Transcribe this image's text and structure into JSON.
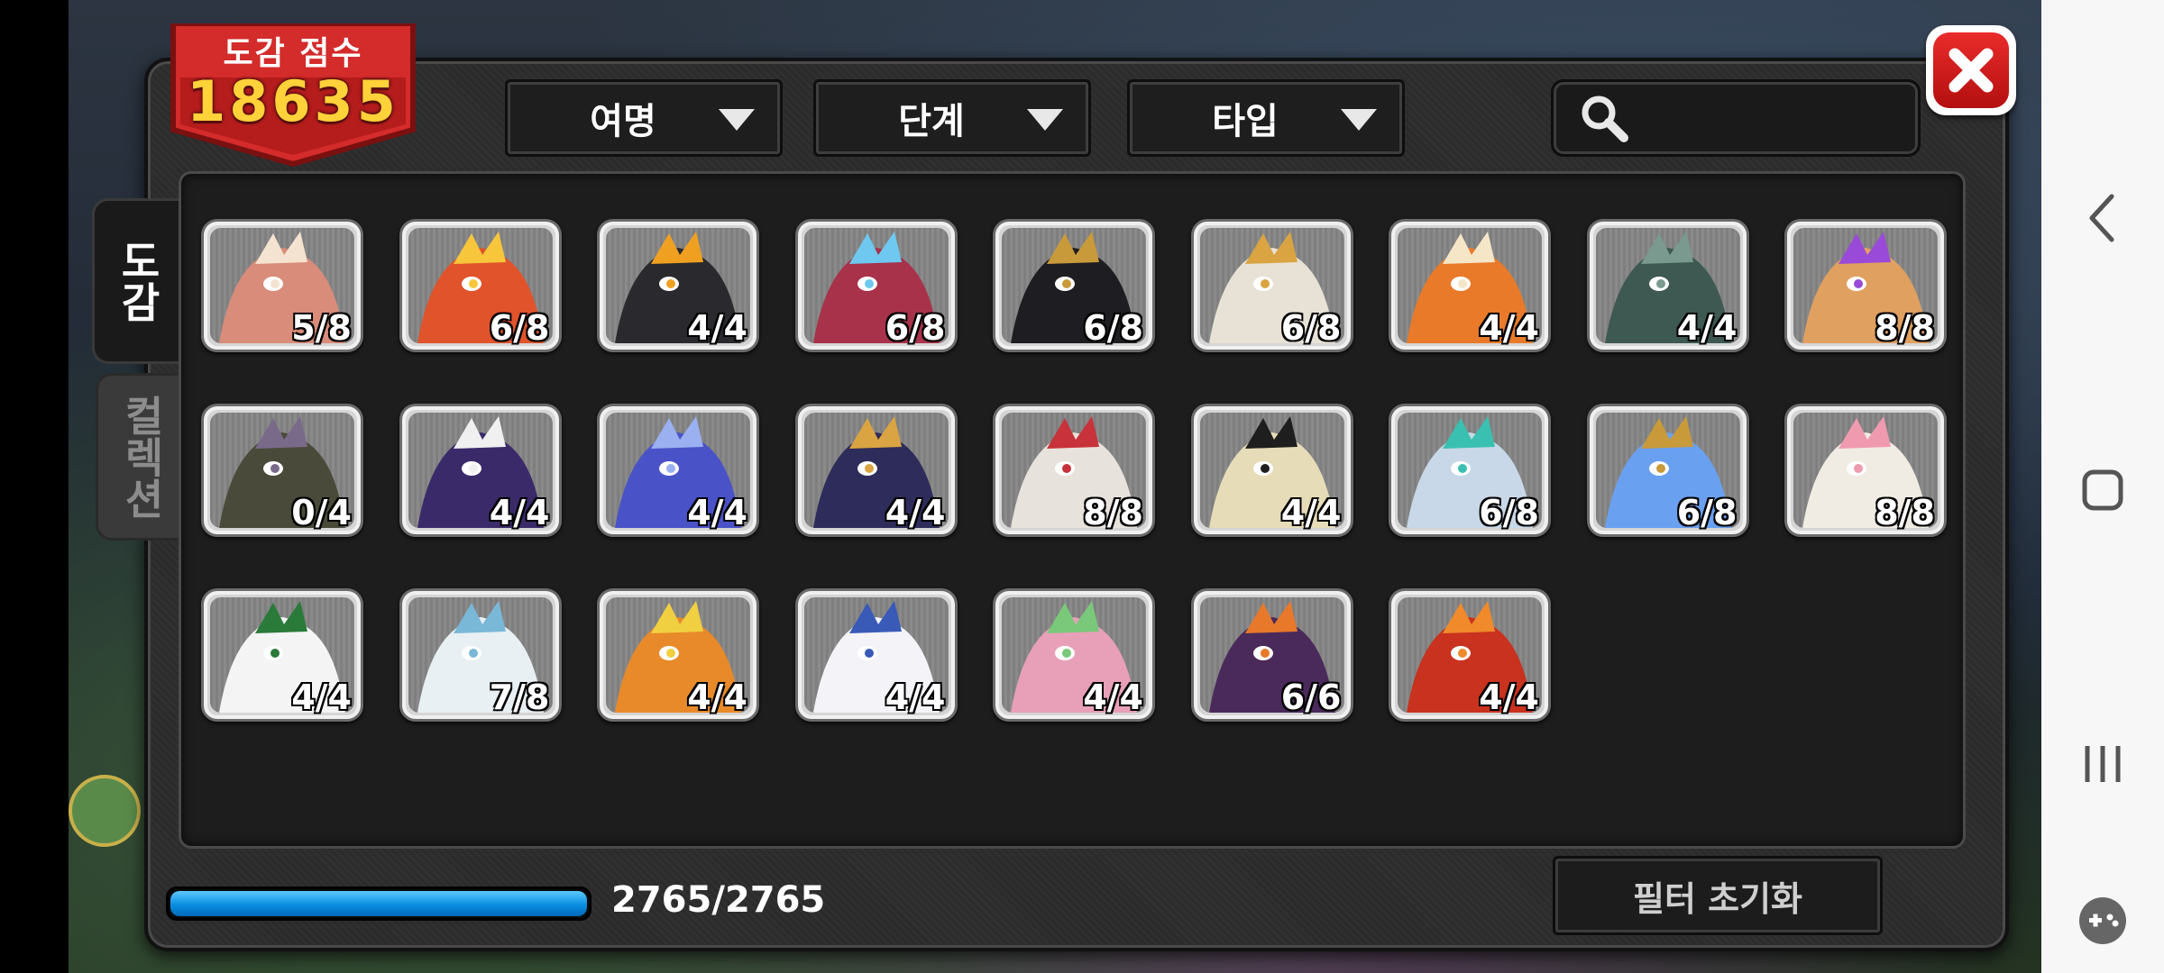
{
  "score": {
    "label": "도감 점수",
    "value": "18635"
  },
  "filters": [
    {
      "label": "여명"
    },
    {
      "label": "단계"
    },
    {
      "label": "타입"
    }
  ],
  "search": {
    "placeholder": "",
    "value": ""
  },
  "tabs": [
    {
      "label": "도감",
      "active": true
    },
    {
      "label": "컬렉션",
      "active": false
    }
  ],
  "collection": {
    "cards": [
      {
        "count": "5/8",
        "color": "#d98c7a",
        "accent": "#f4e3d0"
      },
      {
        "count": "6/8",
        "color": "#e0532b",
        "accent": "#f7c63a"
      },
      {
        "count": "4/4",
        "color": "#2a2a2e",
        "accent": "#f0a020"
      },
      {
        "count": "6/8",
        "color": "#a8324a",
        "accent": "#6ec8f0"
      },
      {
        "count": "6/8",
        "color": "#1e1e22",
        "accent": "#c89a3a"
      },
      {
        "count": "6/8",
        "color": "#e8e2d6",
        "accent": "#d9a441"
      },
      {
        "count": "4/4",
        "color": "#e87a2a",
        "accent": "#f5e6c8"
      },
      {
        "count": "4/4",
        "color": "#3e5852",
        "accent": "#7a9a90"
      },
      {
        "count": "8/8",
        "color": "#e0a060",
        "accent": "#9a4ad8"
      },
      {
        "count": "0/4",
        "color": "#4a4a3a",
        "accent": "#7a6a8a"
      },
      {
        "count": "4/4",
        "color": "#3a2a6a",
        "accent": "#f0f0f0"
      },
      {
        "count": "4/4",
        "color": "#4a52c8",
        "accent": "#9ab0f0"
      },
      {
        "count": "4/4",
        "color": "#2e2c5a",
        "accent": "#d9a441"
      },
      {
        "count": "8/8",
        "color": "#e8e2dc",
        "accent": "#c8323a"
      },
      {
        "count": "4/4",
        "color": "#e6dcb8",
        "accent": "#1e1e1e"
      },
      {
        "count": "6/8",
        "color": "#c8d8e8",
        "accent": "#3ac0b0"
      },
      {
        "count": "6/8",
        "color": "#6aa0f0",
        "accent": "#c89a3a"
      },
      {
        "count": "8/8",
        "color": "#f0ece4",
        "accent": "#f09ab0"
      },
      {
        "count": "4/4",
        "color": "#f4f4f4",
        "accent": "#2a7a3a"
      },
      {
        "count": "7/8",
        "color": "#e8f0f4",
        "accent": "#7ab8d8"
      },
      {
        "count": "4/4",
        "color": "#e88a2a",
        "accent": "#f0d040"
      },
      {
        "count": "4/4",
        "color": "#f4f4f8",
        "accent": "#3a5ab8"
      },
      {
        "count": "4/4",
        "color": "#e8a0b8",
        "accent": "#7ac87a"
      },
      {
        "count": "6/6",
        "color": "#4a2a5a",
        "accent": "#e8782a"
      },
      {
        "count": "4/4",
        "color": "#c8321e",
        "accent": "#f08a2a"
      }
    ]
  },
  "progress": {
    "text": "2765/2765",
    "fraction": 1.0
  },
  "reset_button": {
    "label": "필터 초기화"
  },
  "colors": {
    "accent_blue": "#0b8ee0",
    "score_gold": "#ffd23a",
    "close_red": "#d01c1c"
  },
  "icons": [
    "search-icon",
    "close-icon",
    "back-icon",
    "home-icon",
    "recents-icon",
    "game-tools-icon"
  ]
}
